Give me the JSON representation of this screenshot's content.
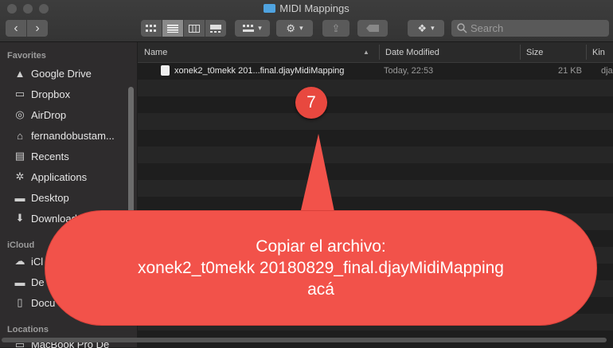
{
  "window": {
    "title": "MIDI Mappings"
  },
  "toolbar": {
    "search_placeholder": "Search"
  },
  "sidebar": {
    "favorites_header": "Favorites",
    "favorites": [
      {
        "label": "Google Drive",
        "icon": "google-drive-icon"
      },
      {
        "label": "Dropbox",
        "icon": "dropbox-icon"
      },
      {
        "label": "AirDrop",
        "icon": "airdrop-icon"
      },
      {
        "label": "fernandobustam...",
        "icon": "home-icon"
      },
      {
        "label": "Recents",
        "icon": "recents-icon"
      },
      {
        "label": "Applications",
        "icon": "applications-icon"
      },
      {
        "label": "Desktop",
        "icon": "desktop-icon"
      },
      {
        "label": "Download",
        "icon": "downloads-icon"
      }
    ],
    "icloud_header": "iCloud",
    "icloud": [
      {
        "label": "iCl",
        "icon": "icloud-icon"
      },
      {
        "label": "De",
        "icon": "desktop-icon"
      },
      {
        "label": "Docu",
        "icon": "documents-icon"
      }
    ],
    "locations_header": "Locations",
    "locations": [
      {
        "label": "MacBook Pro De",
        "icon": "laptop-icon"
      }
    ]
  },
  "columns": {
    "name": "Name",
    "date": "Date Modified",
    "size": "Size",
    "kind": "Kin"
  },
  "files": [
    {
      "name": "xonek2_t0mekk 201...final.djayMidiMapping",
      "date": "Today, 22:53",
      "size": "21 KB",
      "kind": "dja"
    }
  ],
  "annotation": {
    "step": "7",
    "lines": [
      "Copiar el archivo:",
      "xonek2_t0mekk 20180829_final.djayMidiMapping",
      "acá"
    ],
    "color": "#f2524a"
  }
}
